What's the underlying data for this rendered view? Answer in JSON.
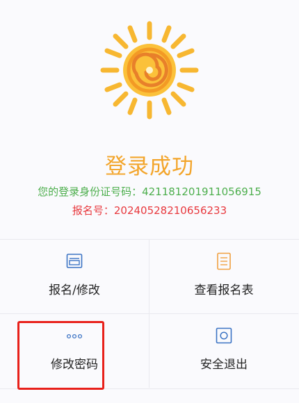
{
  "status": {
    "title": "登录成功",
    "id_line": "您的登录身份证号码：421181201911056915",
    "reg_line": "报名号：20240528210656233"
  },
  "menu": {
    "items": [
      {
        "label": "报名/修改",
        "icon": "form-icon"
      },
      {
        "label": "查看报名表",
        "icon": "document-icon"
      },
      {
        "label": "修改密码",
        "icon": "dots-icon"
      },
      {
        "label": "安全退出",
        "icon": "exit-icon"
      }
    ]
  },
  "colors": {
    "title": "#f3a52b",
    "id_line": "#4cae4c",
    "reg_line": "#e8383d",
    "icon_blue": "#3b73c4",
    "icon_orange": "#f0a040",
    "highlight": "#e8201a"
  }
}
